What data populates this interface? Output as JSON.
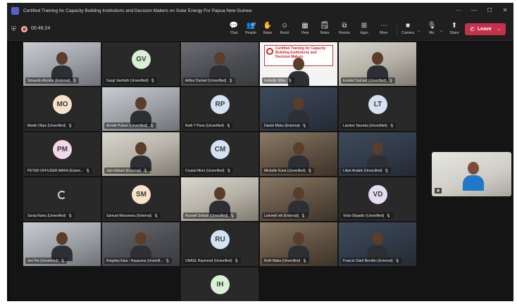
{
  "window": {
    "title": "Certified Training for Capacity Building Institutions and Decision Makers on Solar Energy For Papua New Guinea",
    "controls": [
      "⋯",
      "—",
      "☐",
      "✕"
    ]
  },
  "toolbar": {
    "timer": "00:46:24",
    "buttons": [
      {
        "label": "Chat",
        "icon": "chat-icon",
        "glyph": "💬"
      },
      {
        "label": "People",
        "icon": "people-icon",
        "glyph": "👥",
        "badge": "27"
      },
      {
        "label": "Raise",
        "icon": "raise-hand-icon",
        "glyph": "✋"
      },
      {
        "label": "React",
        "icon": "react-icon",
        "glyph": "☺"
      },
      {
        "label": "View",
        "icon": "view-icon",
        "glyph": "▦"
      },
      {
        "label": "Notes",
        "icon": "notes-icon",
        "glyph": "🗒"
      },
      {
        "label": "Rooms",
        "icon": "rooms-icon",
        "glyph": "⧉"
      },
      {
        "label": "Apps",
        "icon": "apps-icon",
        "glyph": "⊞"
      },
      {
        "label": "More",
        "icon": "more-icon",
        "glyph": "⋯"
      }
    ],
    "camera_label": "Camera",
    "mic_label": "Mic",
    "share_label": "Share",
    "leave_label": "Leave"
  },
  "participants": [
    {
      "name": "Sinaurdo Alcolde (External)",
      "type": "video",
      "style": "v2"
    },
    {
      "name": "Gargi Vashisth (Unverified)",
      "type": "avatar",
      "initials": "GV",
      "color": "#d9efd6"
    },
    {
      "name": "Arthur Dumari (Unverified)",
      "type": "video",
      "style": "video"
    },
    {
      "name": "Indradip Mitra",
      "type": "share"
    },
    {
      "name": "Ezekiel Samuel (Unverified)",
      "type": "video",
      "style": "v4"
    },
    {
      "name": "Martin Okpo (Unverified)",
      "type": "avatar",
      "initials": "MO",
      "color": "#f7e3c9"
    },
    {
      "name": "Arnold Pulsen (Unverified)",
      "type": "video",
      "style": "v2"
    },
    {
      "name": "Ruth T Pune (Unverified)",
      "type": "avatar",
      "initials": "RP",
      "color": "#d6e2f3"
    },
    {
      "name": "Daniel Moku (External)",
      "type": "video",
      "style": "v5"
    },
    {
      "name": "Landon Taureka (Unverified)",
      "type": "avatar",
      "initials": "LT",
      "color": "#d6e2f3"
    },
    {
      "name": "PETER OFFUGER MAKA (Extern...",
      "type": "avatar",
      "initials": "PM",
      "color": "#f3d6ea"
    },
    {
      "name": "Jojo Aribam (External)",
      "type": "video",
      "style": "v4"
    },
    {
      "name": "Crystal Moro (Unverified)",
      "type": "avatar",
      "initials": "CM",
      "color": "#d6e2f3"
    },
    {
      "name": "Michelle Kuna (Unverified)",
      "type": "video",
      "style": "v3"
    },
    {
      "name": "Lilian Andale (Unverified)",
      "type": "video",
      "style": "v5"
    },
    {
      "name": "Sonia Rainu (Unverified)",
      "type": "loading"
    },
    {
      "name": "Samuel Mosonesu (External)",
      "type": "avatar",
      "initials": "SM",
      "color": "#f7e3c9"
    },
    {
      "name": "Russell Solope (Unverified)",
      "type": "video",
      "style": "v4"
    },
    {
      "name": "Lumwell eik (External)",
      "type": "video",
      "style": "v3"
    },
    {
      "name": "Viola Okpadio (Unverified)",
      "type": "avatar",
      "initials": "VD",
      "color": "#e4dcf3"
    },
    {
      "name": "Jeri Pio (Unverified)",
      "type": "video",
      "style": "v2"
    },
    {
      "name": "Kingsley Kaia - Rayarana (Unverifi...",
      "type": "video",
      "style": "video"
    },
    {
      "name": "UNASL Raymond (Unverified)",
      "type": "avatar",
      "initials": "RU",
      "color": "#d6e2f3"
    },
    {
      "name": "Ruth Maka (Unverified)",
      "type": "video",
      "style": "v3"
    },
    {
      "name": "Francis Clark Bendim (External)",
      "type": "video",
      "style": "v5"
    },
    {
      "name": "Ivan Ivagara (Unverified)",
      "type": "avatar",
      "initials": "IH",
      "color": "#d9efd6"
    }
  ],
  "share_slide_text": "Certified Training for Capacity Building Institutions and Decision Makers",
  "self_view": {
    "badge": "▣"
  }
}
